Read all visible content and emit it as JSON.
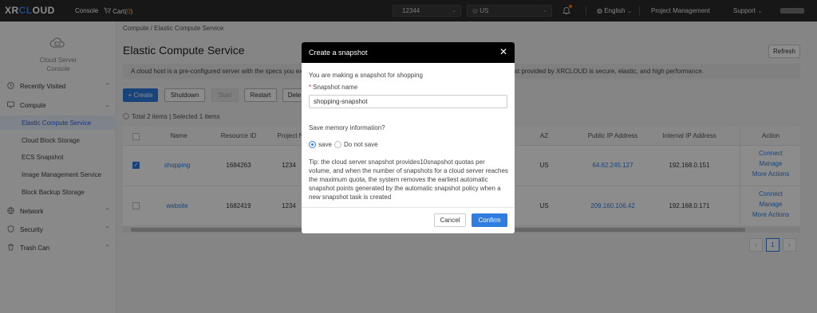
{
  "topbar": {
    "logo_a": "XR",
    "logo_b": "CL",
    "logo_c": "OUD",
    "console": "Console",
    "cart_label": "Cart(",
    "cart_count": "0",
    "cart_close": ")",
    "project_select": "12344",
    "region_select": "US",
    "language": "English",
    "project_mgmt": "Project Management",
    "support": "Support"
  },
  "sidebar": {
    "cloud_server_line1": "Cloud Server",
    "cloud_server_line2": "Console",
    "recently_visited": "Recently Visited",
    "compute": "Compute",
    "sub": [
      "Elastic Compute Service",
      "Cloud Block Storage",
      "ECS Snapshot",
      "Image Management Service",
      "Block Backup Storage"
    ],
    "network": "Network",
    "security": "Security",
    "trash": "Trash Can"
  },
  "main": {
    "breadcrumb": "Compute / Elastic Compute Service",
    "title": "Elastic Compute Service",
    "refresh": "Refresh",
    "info_left": "A cloud host is a pre-configured server with the specs you expe",
    "info_right": "st provided by XRCLOUD is secure, elastic, and high performance.",
    "buttons": {
      "create": "+ Create",
      "shutdown": "Shutdown",
      "start": "Start",
      "restart": "Restart",
      "delete": "Dele"
    },
    "total": "Total 2 items | Selected 1 items",
    "columns": {
      "name": "Name",
      "resource_id": "Resource ID",
      "project": "Project N",
      "az": "AZ",
      "public_ip": "Public IP Address",
      "internal_ip": "Internal IP Address",
      "action": "Action"
    },
    "rows": [
      {
        "name": "shopping",
        "resource_id": "1684263",
        "project": "1234",
        "az": "US",
        "public_ip": "64.62.245.127",
        "internal_ip": "192.168.0.151",
        "actions": [
          "Connect",
          "Manage",
          "More Actions"
        ]
      },
      {
        "name": "website",
        "resource_id": "1682419",
        "project": "1234",
        "az": "US",
        "public_ip": "209.160.106.42",
        "internal_ip": "192.168.0.171",
        "actions": [
          "Connect",
          "Manage",
          "More Actions"
        ]
      }
    ],
    "pagination": {
      "prev": "‹",
      "current": "1",
      "next": "›"
    }
  },
  "modal": {
    "title": "Create a snapshot",
    "close": "✕",
    "intro": "You are making a snapshot for shopping",
    "name_label": "Snapshot name",
    "name_value": "shopping-snapshot",
    "memory_question": "Save memory information?",
    "opt_save": "save",
    "opt_nosave": "Do not save",
    "tip": "Tip: the cloud server snapshot provides10snapshot quotas per volume, and when the number of snapshots for a cloud server reaches the maximum quota, the system removes the earliest automatic snapshot points generated by the automatic snapshot policy when a new snapshot task is created",
    "cancel": "Cancel",
    "confirm": "Confirm"
  },
  "colors": {
    "accent": "#2f7de1",
    "topbar": "#2b2b2b",
    "modal_header": "#000000"
  }
}
